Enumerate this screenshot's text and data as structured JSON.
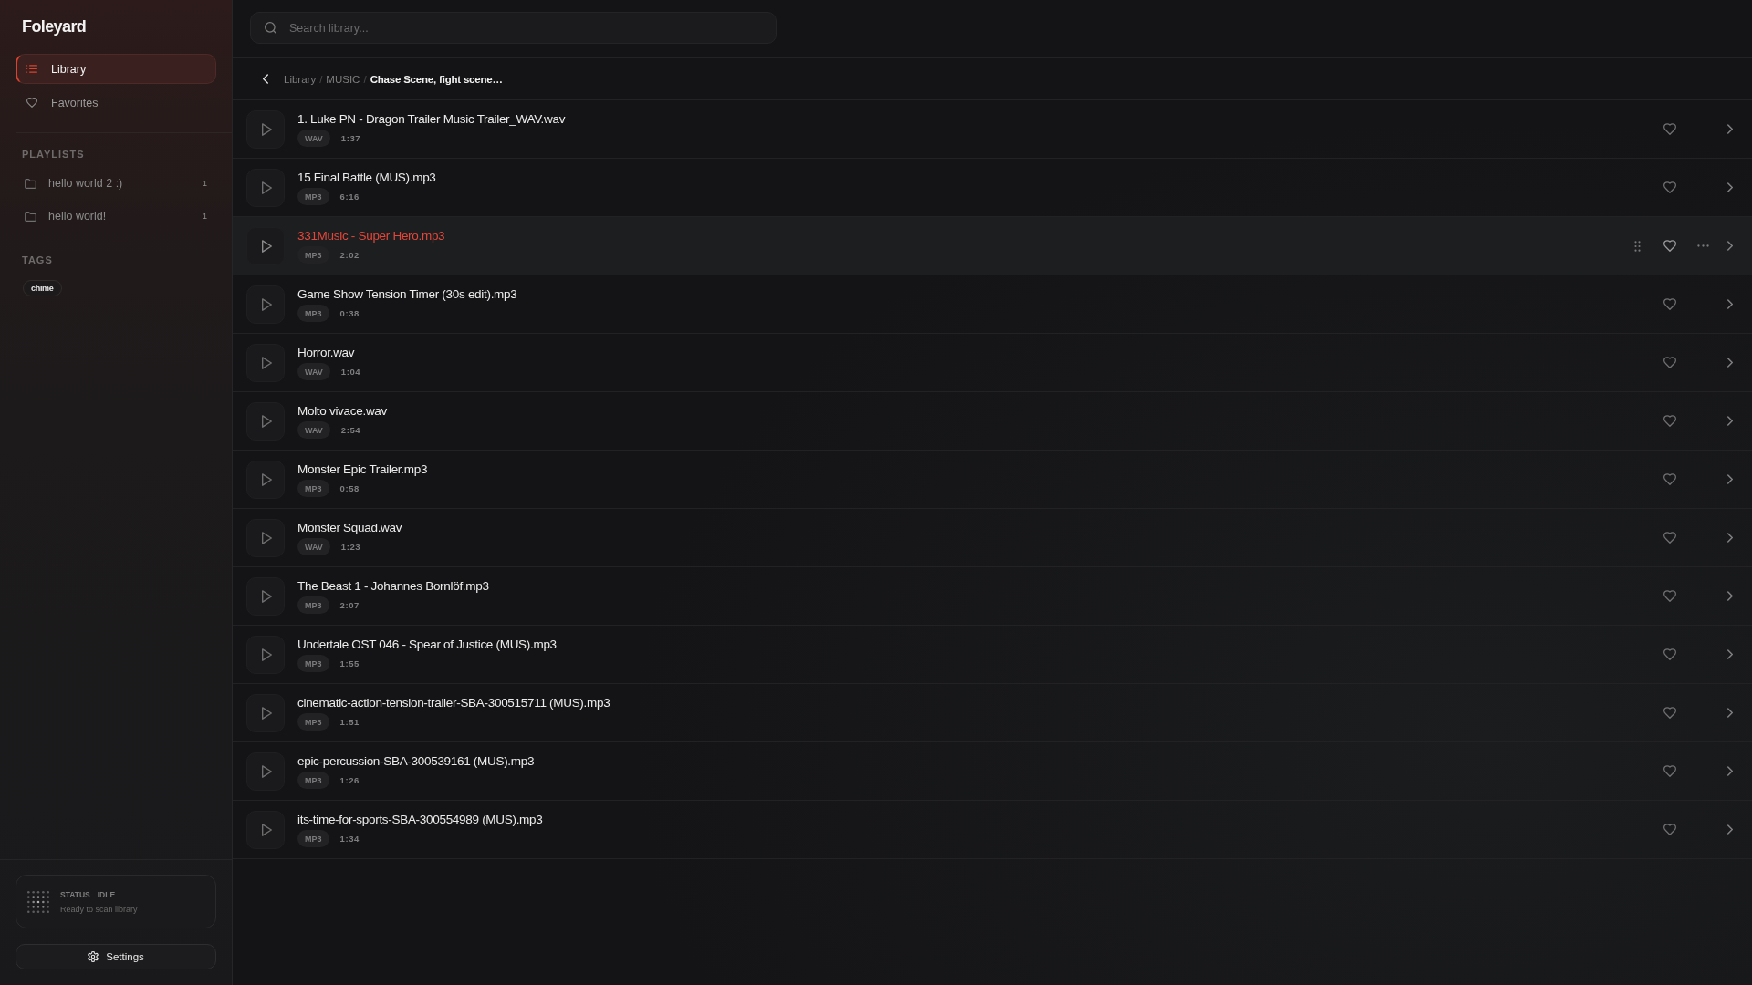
{
  "sidebar": {
    "app_name": "Foleyard",
    "nav": [
      {
        "label": "Library",
        "selected": true
      },
      {
        "label": "Favorites",
        "selected": false
      }
    ],
    "playlists_heading": "PLAYLISTS",
    "playlists": [
      {
        "name": "hello world 2 :)",
        "count": "1"
      },
      {
        "name": "hello world!",
        "count": "1"
      }
    ],
    "tags_heading": "TAGS",
    "tags": [
      "chime"
    ],
    "status": {
      "label": "STATUS",
      "value": "IDLE",
      "message": "Ready to scan library"
    },
    "settings_button": "Settings"
  },
  "search": {
    "placeholder": "Search library..."
  },
  "breadcrumb": {
    "separator": "/",
    "items": [
      {
        "label": "Library",
        "current": false
      },
      {
        "label": "MUSIC",
        "current": false
      },
      {
        "label": "Chase Scene, fight scene…",
        "current": true
      }
    ]
  },
  "tracks": [
    {
      "title": "1. Luke PN - Dragon Trailer Music Trailer_WAV.wav",
      "format": "WAV",
      "duration": "1:37",
      "selected": false,
      "favorite": false
    },
    {
      "title": "15 Final Battle (MUS).mp3",
      "format": "MP3",
      "duration": "6:16",
      "selected": false,
      "favorite": false
    },
    {
      "title": "331Music - Super Hero.mp3",
      "format": "MP3",
      "duration": "2:02",
      "selected": true,
      "favorite": false
    },
    {
      "title": "Game Show Tension Timer (30s edit).mp3",
      "format": "MP3",
      "duration": "0:38",
      "selected": false,
      "favorite": false
    },
    {
      "title": "Horror.wav",
      "format": "WAV",
      "duration": "1:04",
      "selected": false,
      "favorite": false
    },
    {
      "title": "Molto vivace.wav",
      "format": "WAV",
      "duration": "2:54",
      "selected": false,
      "favorite": false
    },
    {
      "title": "Monster Epic Trailer.mp3",
      "format": "MP3",
      "duration": "0:58",
      "selected": false,
      "favorite": false
    },
    {
      "title": "Monster Squad.wav",
      "format": "WAV",
      "duration": "1:23",
      "selected": false,
      "favorite": false
    },
    {
      "title": "The Beast 1 - Johannes Bornlöf.mp3",
      "format": "MP3",
      "duration": "2:07",
      "selected": false,
      "favorite": false
    },
    {
      "title": "Undertale OST 046 - Spear of Justice (MUS).mp3",
      "format": "MP3",
      "duration": "1:55",
      "selected": false,
      "favorite": false
    },
    {
      "title": "cinematic-action-tension-trailer-SBA-300515711 (MUS).mp3",
      "format": "MP3",
      "duration": "1:51",
      "selected": false,
      "favorite": false
    },
    {
      "title": "epic-percussion-SBA-300539161 (MUS).mp3",
      "format": "MP3",
      "duration": "1:26",
      "selected": false,
      "favorite": false
    },
    {
      "title": "its-time-for-sports-SBA-300554989 (MUS).mp3",
      "format": "MP3",
      "duration": "1:34",
      "selected": false,
      "favorite": false
    }
  ]
}
